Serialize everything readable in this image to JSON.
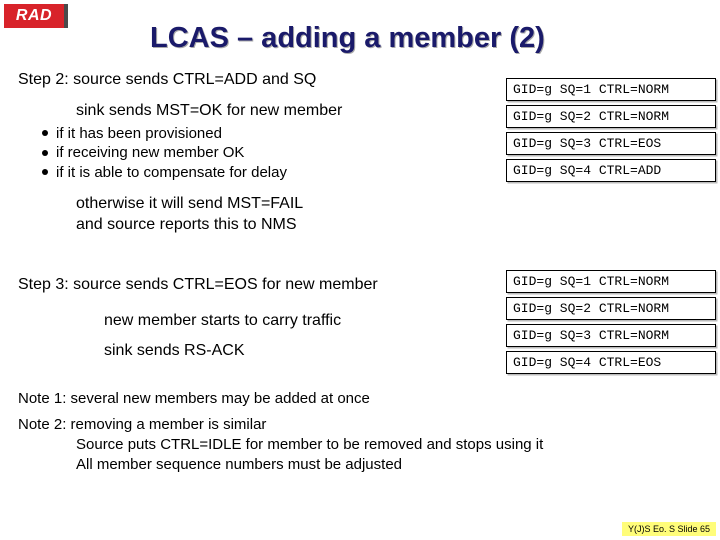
{
  "logo_text": "RAD",
  "title": "LCAS – adding a member (2)",
  "step2": {
    "heading": "Step 2: source sends CTRL=ADD and SQ",
    "sink_line": "sink sends MST=OK for new member",
    "bullets": [
      "if it has been provisioned",
      "if receiving new member OK",
      "if it is able to compensate for delay"
    ],
    "otherwise_l1": "otherwise it will send MST=FAIL",
    "otherwise_l2": "and source reports this to NMS",
    "boxes": [
      "GID=g SQ=1 CTRL=NORM",
      "GID=g SQ=2 CTRL=NORM",
      "GID=g SQ=3 CTRL=EOS",
      "GID=g SQ=4 CTRL=ADD"
    ]
  },
  "step3": {
    "heading": "Step 3: source sends CTRL=EOS for new member",
    "line1": "new member starts to carry traffic",
    "line2": "sink sends RS-ACK",
    "boxes": [
      "GID=g SQ=1 CTRL=NORM",
      "GID=g SQ=2 CTRL=NORM",
      "GID=g SQ=3 CTRL=NORM",
      "GID=g SQ=4 CTRL=EOS"
    ]
  },
  "note1": "Note 1: several new members may be added at once",
  "note2_head": "Note 2: removing a member is similar",
  "note2_l1": "Source puts CTRL=IDLE for member to be removed and stops using it",
  "note2_l2": "All member sequence numbers must be adjusted",
  "footer": "Y(J)S Eo. S  Slide 65"
}
